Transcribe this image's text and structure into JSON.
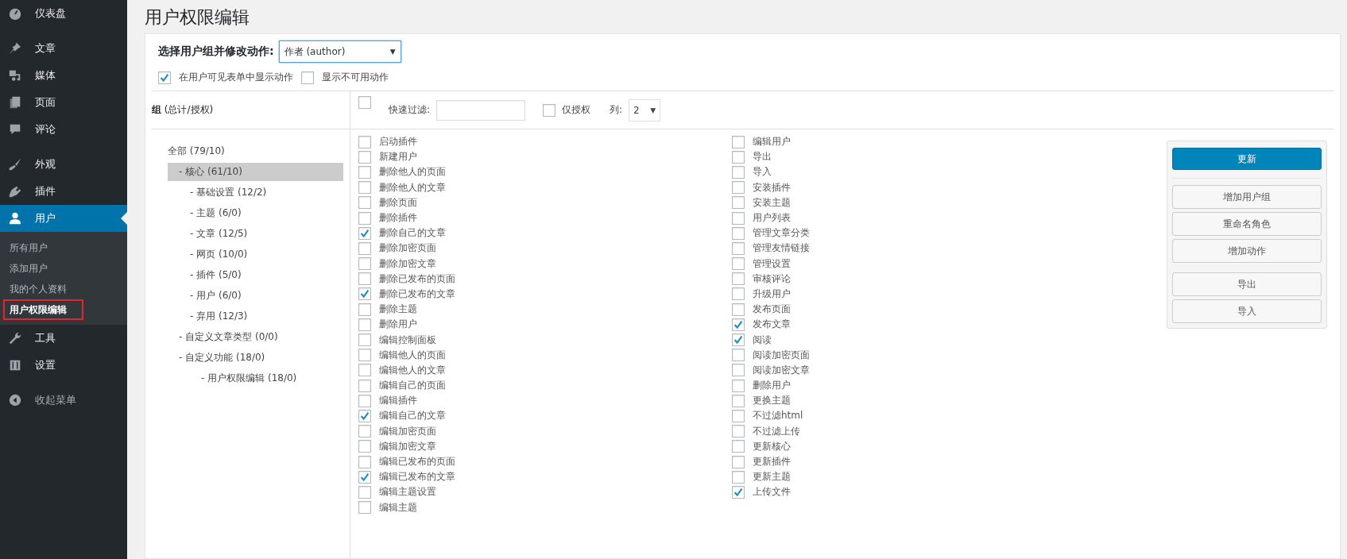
{
  "sidebar": {
    "menu_groups": [
      [
        {
          "label": "仪表盘",
          "selected": false
        }
      ],
      [
        {
          "label": "文章",
          "selected": false
        },
        {
          "label": "媒体",
          "selected": false
        },
        {
          "label": "页面",
          "selected": false
        },
        {
          "label": "评论",
          "selected": false
        }
      ],
      [
        {
          "label": "外观",
          "selected": false
        },
        {
          "label": "插件",
          "selected": false
        },
        {
          "label": "用户",
          "selected": true,
          "submenu": [
            {
              "label": "所有用户",
              "selected": false,
              "highlighted": false
            },
            {
              "label": "添加用户",
              "selected": false,
              "highlighted": false
            },
            {
              "label": "我的个人资料",
              "selected": false,
              "highlighted": false
            },
            {
              "label": "用户权限编辑",
              "selected": true,
              "highlighted": true
            }
          ]
        },
        {
          "label": "工具",
          "selected": false
        },
        {
          "label": "设置",
          "selected": false
        }
      ]
    ],
    "collapse": "收起菜单"
  },
  "page_title": "用户权限编辑",
  "role_select": {
    "label": "选择用户组并修改动作:",
    "value": "作者 (author)",
    "caret": "▼"
  },
  "options": [
    {
      "label": "在用户可见表单中显示动作",
      "checked": true
    },
    {
      "label": "显示不可用动作",
      "checked": false
    }
  ],
  "groups_header": {
    "title": "组",
    "subtitle": "(总计/授权)"
  },
  "group_tree": [
    {
      "label": "全部 (79/10)",
      "selected": false,
      "children": [
        {
          "label": "- 核心 (61/10)",
          "selected": true,
          "children": [
            {
              "label": "- 基础设置 (12/2)",
              "selected": false
            },
            {
              "label": "- 主题 (6/0)",
              "selected": false
            },
            {
              "label": "- 文章 (12/5)",
              "selected": false
            },
            {
              "label": "- 网页 (10/0)",
              "selected": false
            },
            {
              "label": "- 插件 (5/0)",
              "selected": false
            },
            {
              "label": "- 用户 (6/0)",
              "selected": false
            },
            {
              "label": "- 弃用 (12/3)",
              "selected": false
            }
          ]
        },
        {
          "label": "- 自定义文章类型 (0/0)",
          "selected": false
        },
        {
          "label": "- 自定义功能 (18/0)",
          "selected": false,
          "children": [
            {
              "label": "- 用户权限编辑 (18/0)",
              "selected": false
            }
          ]
        }
      ]
    }
  ],
  "filter": {
    "select_all_checked": false,
    "label": "快速过滤:",
    "granted_only": {
      "label": "仅授权",
      "checked": false
    },
    "columns_label": "列:",
    "columns_value": "2",
    "columns_caret": "▼"
  },
  "capabilities": [
    [
      {
        "label": "启动插件",
        "checked": false
      },
      {
        "label": "新建用户",
        "checked": false
      },
      {
        "label": "删除他人的页面",
        "checked": false
      },
      {
        "label": "删除他人的文章",
        "checked": false
      },
      {
        "label": "删除页面",
        "checked": false
      },
      {
        "label": "删除插件",
        "checked": false
      },
      {
        "label": "删除自己的文章",
        "checked": true
      },
      {
        "label": "删除加密页面",
        "checked": false
      },
      {
        "label": "删除加密文章",
        "checked": false
      },
      {
        "label": "删除已发布的页面",
        "checked": false
      },
      {
        "label": "删除已发布的文章",
        "checked": true
      },
      {
        "label": "删除主题",
        "checked": false
      },
      {
        "label": "删除用户",
        "checked": false
      },
      {
        "label": "编辑控制面板",
        "checked": false
      },
      {
        "label": "编辑他人的页面",
        "checked": false
      },
      {
        "label": "编辑他人的文章",
        "checked": false
      },
      {
        "label": "编辑自己的页面",
        "checked": false
      },
      {
        "label": "编辑插件",
        "checked": false
      },
      {
        "label": "编辑自己的文章",
        "checked": true
      },
      {
        "label": "编辑加密页面",
        "checked": false
      },
      {
        "label": "编辑加密文章",
        "checked": false
      },
      {
        "label": "编辑已发布的页面",
        "checked": false
      },
      {
        "label": "编辑已发布的文章",
        "checked": true
      },
      {
        "label": "编辑主题设置",
        "checked": false
      },
      {
        "label": "编辑主题",
        "checked": false
      }
    ],
    [
      {
        "label": "编辑用户",
        "checked": false
      },
      {
        "label": "导出",
        "checked": false
      },
      {
        "label": "导入",
        "checked": false
      },
      {
        "label": "安装插件",
        "checked": false
      },
      {
        "label": "安装主题",
        "checked": false
      },
      {
        "label": "用户列表",
        "checked": false
      },
      {
        "label": "管理文章分类",
        "checked": false
      },
      {
        "label": "管理友情链接",
        "checked": false
      },
      {
        "label": "管理设置",
        "checked": false
      },
      {
        "label": "审核评论",
        "checked": false
      },
      {
        "label": "升级用户",
        "checked": false
      },
      {
        "label": "发布页面",
        "checked": false
      },
      {
        "label": "发布文章",
        "checked": true
      },
      {
        "label": "阅读",
        "checked": true
      },
      {
        "label": "阅读加密页面",
        "checked": false
      },
      {
        "label": "阅读加密文章",
        "checked": false
      },
      {
        "label": "删除用户",
        "checked": false
      },
      {
        "label": "更换主题",
        "checked": false
      },
      {
        "label": "不过滤html",
        "checked": false
      },
      {
        "label": "不过滤上传",
        "checked": false
      },
      {
        "label": "更新核心",
        "checked": false
      },
      {
        "label": "更新插件",
        "checked": false
      },
      {
        "label": "更新主题",
        "checked": false
      },
      {
        "label": "上传文件",
        "checked": true
      }
    ]
  ],
  "actions": {
    "primary": "更新",
    "button_groups": [
      [
        "增加用户组",
        "重命名角色",
        "增加动作"
      ],
      [
        "导出",
        "导入"
      ]
    ]
  }
}
